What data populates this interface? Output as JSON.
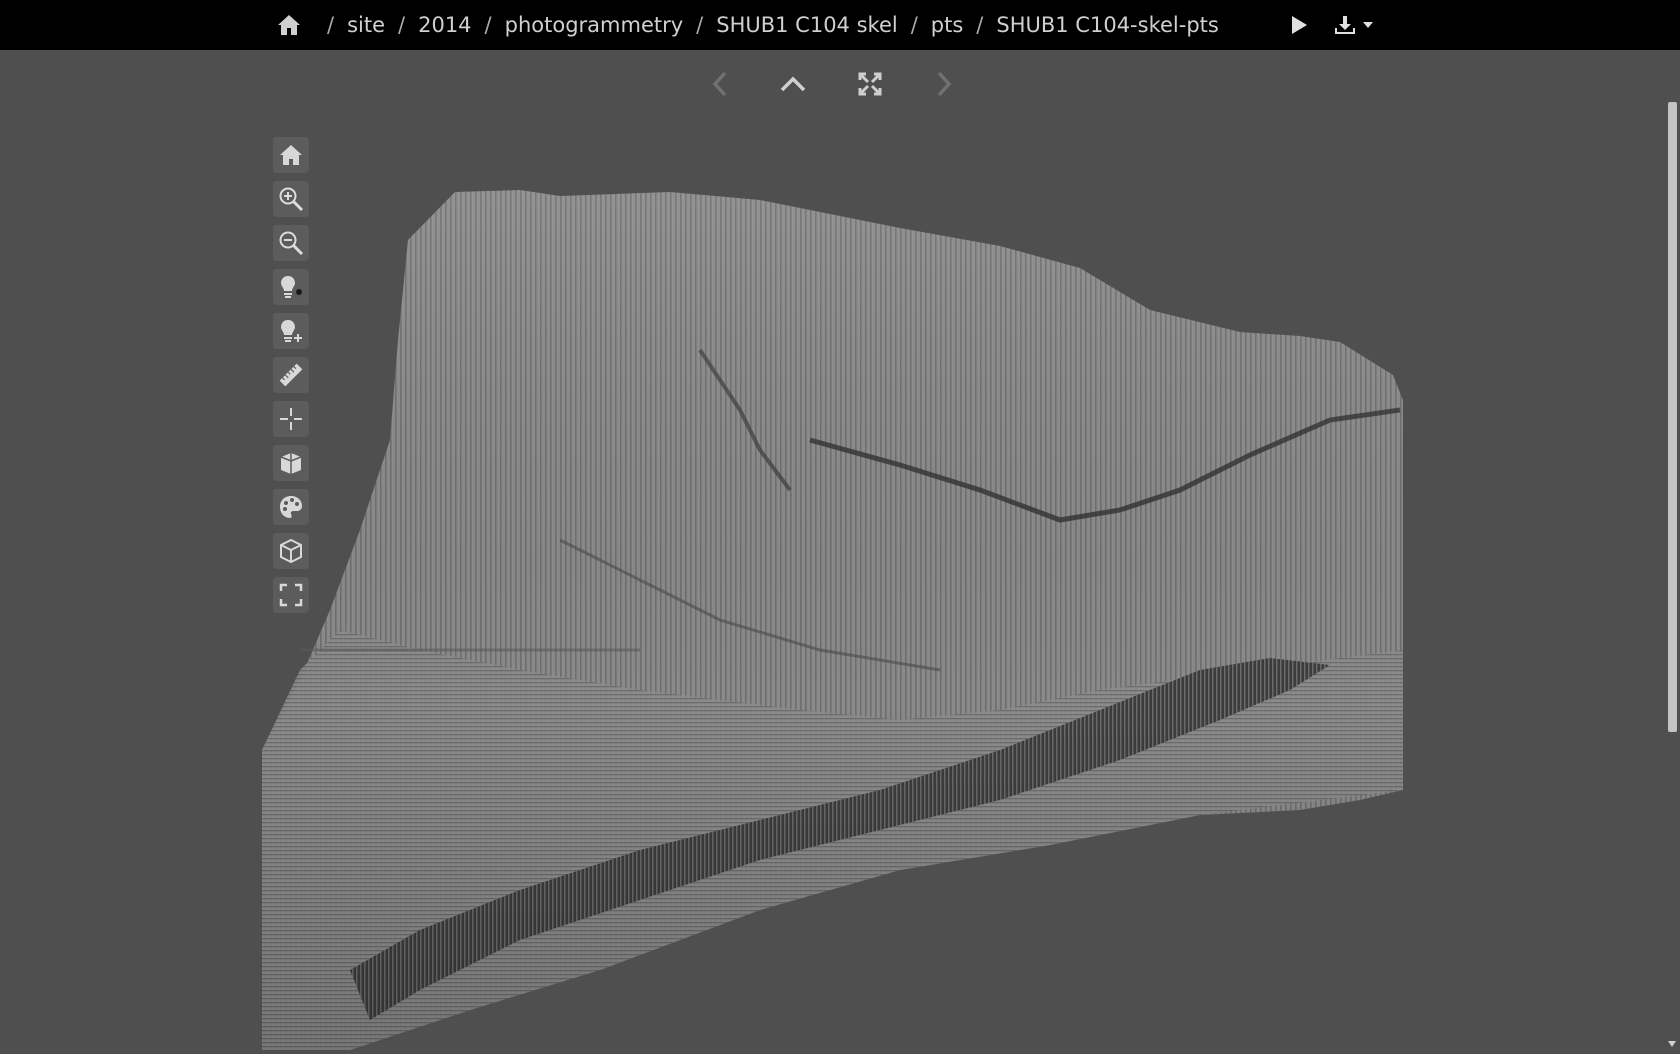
{
  "breadcrumb": {
    "items": [
      "site",
      "2014",
      "photogrammetry",
      "SHUB1 C104 skel",
      "pts",
      "SHUB1 C104-skel-pts"
    ],
    "separator": "/"
  },
  "top_actions": [
    "play-icon",
    "download-icon"
  ],
  "nav": [
    "chevron-left-icon",
    "chevron-up-icon",
    "expand-icon",
    "chevron-right-icon"
  ],
  "viewer_tools": [
    "home-icon",
    "zoom-in-icon",
    "zoom-out-icon",
    "light-toggle-icon",
    "light-add-icon",
    "measure-icon",
    "pick-point-icon",
    "section-icon",
    "color-icon",
    "orthographic-cube-icon",
    "fullscreen-icon"
  ],
  "colors": {
    "topbar": "#000000",
    "background": "#4f4f4f",
    "tool_button": "#5c5c5c",
    "icon": "#c8c8c8"
  }
}
